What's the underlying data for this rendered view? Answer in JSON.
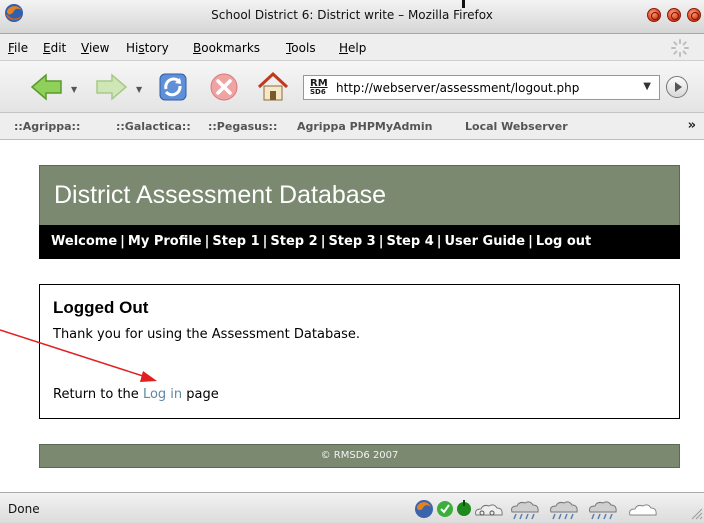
{
  "window": {
    "title": "School District 6: District write – Mozilla Firefox"
  },
  "menu": {
    "items": [
      {
        "label": "File",
        "hotkey": "F",
        "rest": "ile"
      },
      {
        "label": "Edit",
        "hotkey": "E",
        "rest": "dit"
      },
      {
        "label": "View",
        "hotkey": "V",
        "rest": "iew"
      },
      {
        "label": "History",
        "hotkey": "s",
        "pre": "Hi",
        "rest": "tory"
      },
      {
        "label": "Bookmarks",
        "hotkey": "B",
        "rest": "ookmarks"
      },
      {
        "label": "Tools",
        "hotkey": "T",
        "rest": "ools"
      },
      {
        "label": "Help",
        "hotkey": "H",
        "rest": "elp"
      }
    ]
  },
  "navbar": {
    "url": "http://webserver/assessment/logout.php",
    "favicon_top": "RM",
    "favicon_bottom": "SD6",
    "icons": [
      "back-arrow-icon",
      "forward-arrow-icon",
      "reload-icon",
      "stop-icon",
      "home-icon",
      "go-icon"
    ]
  },
  "bookmarks": {
    "items": [
      "::Agrippa::",
      "::Galactica::",
      "::Pegasus::",
      "Agrippa PHPMyAdmin",
      "Local Webserver"
    ],
    "overflow": "»"
  },
  "page": {
    "header_title": "District Assessment Database",
    "nav": [
      "Welcome",
      "My Profile",
      "Step 1",
      "Step 2",
      "Step 3",
      "Step 4",
      "User Guide",
      "Log out"
    ],
    "nav_separator": "|",
    "heading": "Logged Out",
    "message": "Thank you for using the Assessment Database.",
    "return_prefix": "Return to the",
    "return_link": "Log in",
    "return_suffix": "page",
    "footer": "© RMSD6 2007",
    "colors": {
      "header_bg": "#7a8970",
      "nav_bg": "#000000",
      "link": "#5d88a6",
      "annotation_arrow": "#e02020"
    }
  },
  "status": {
    "text": "Done",
    "icons": [
      "firefox-icon",
      "check-icon",
      "green-dot-icon",
      "cloud-icon",
      "rain-cloud-icon",
      "rain-cloud-icon",
      "rain-cloud-icon",
      "cloud-outline-icon"
    ]
  }
}
